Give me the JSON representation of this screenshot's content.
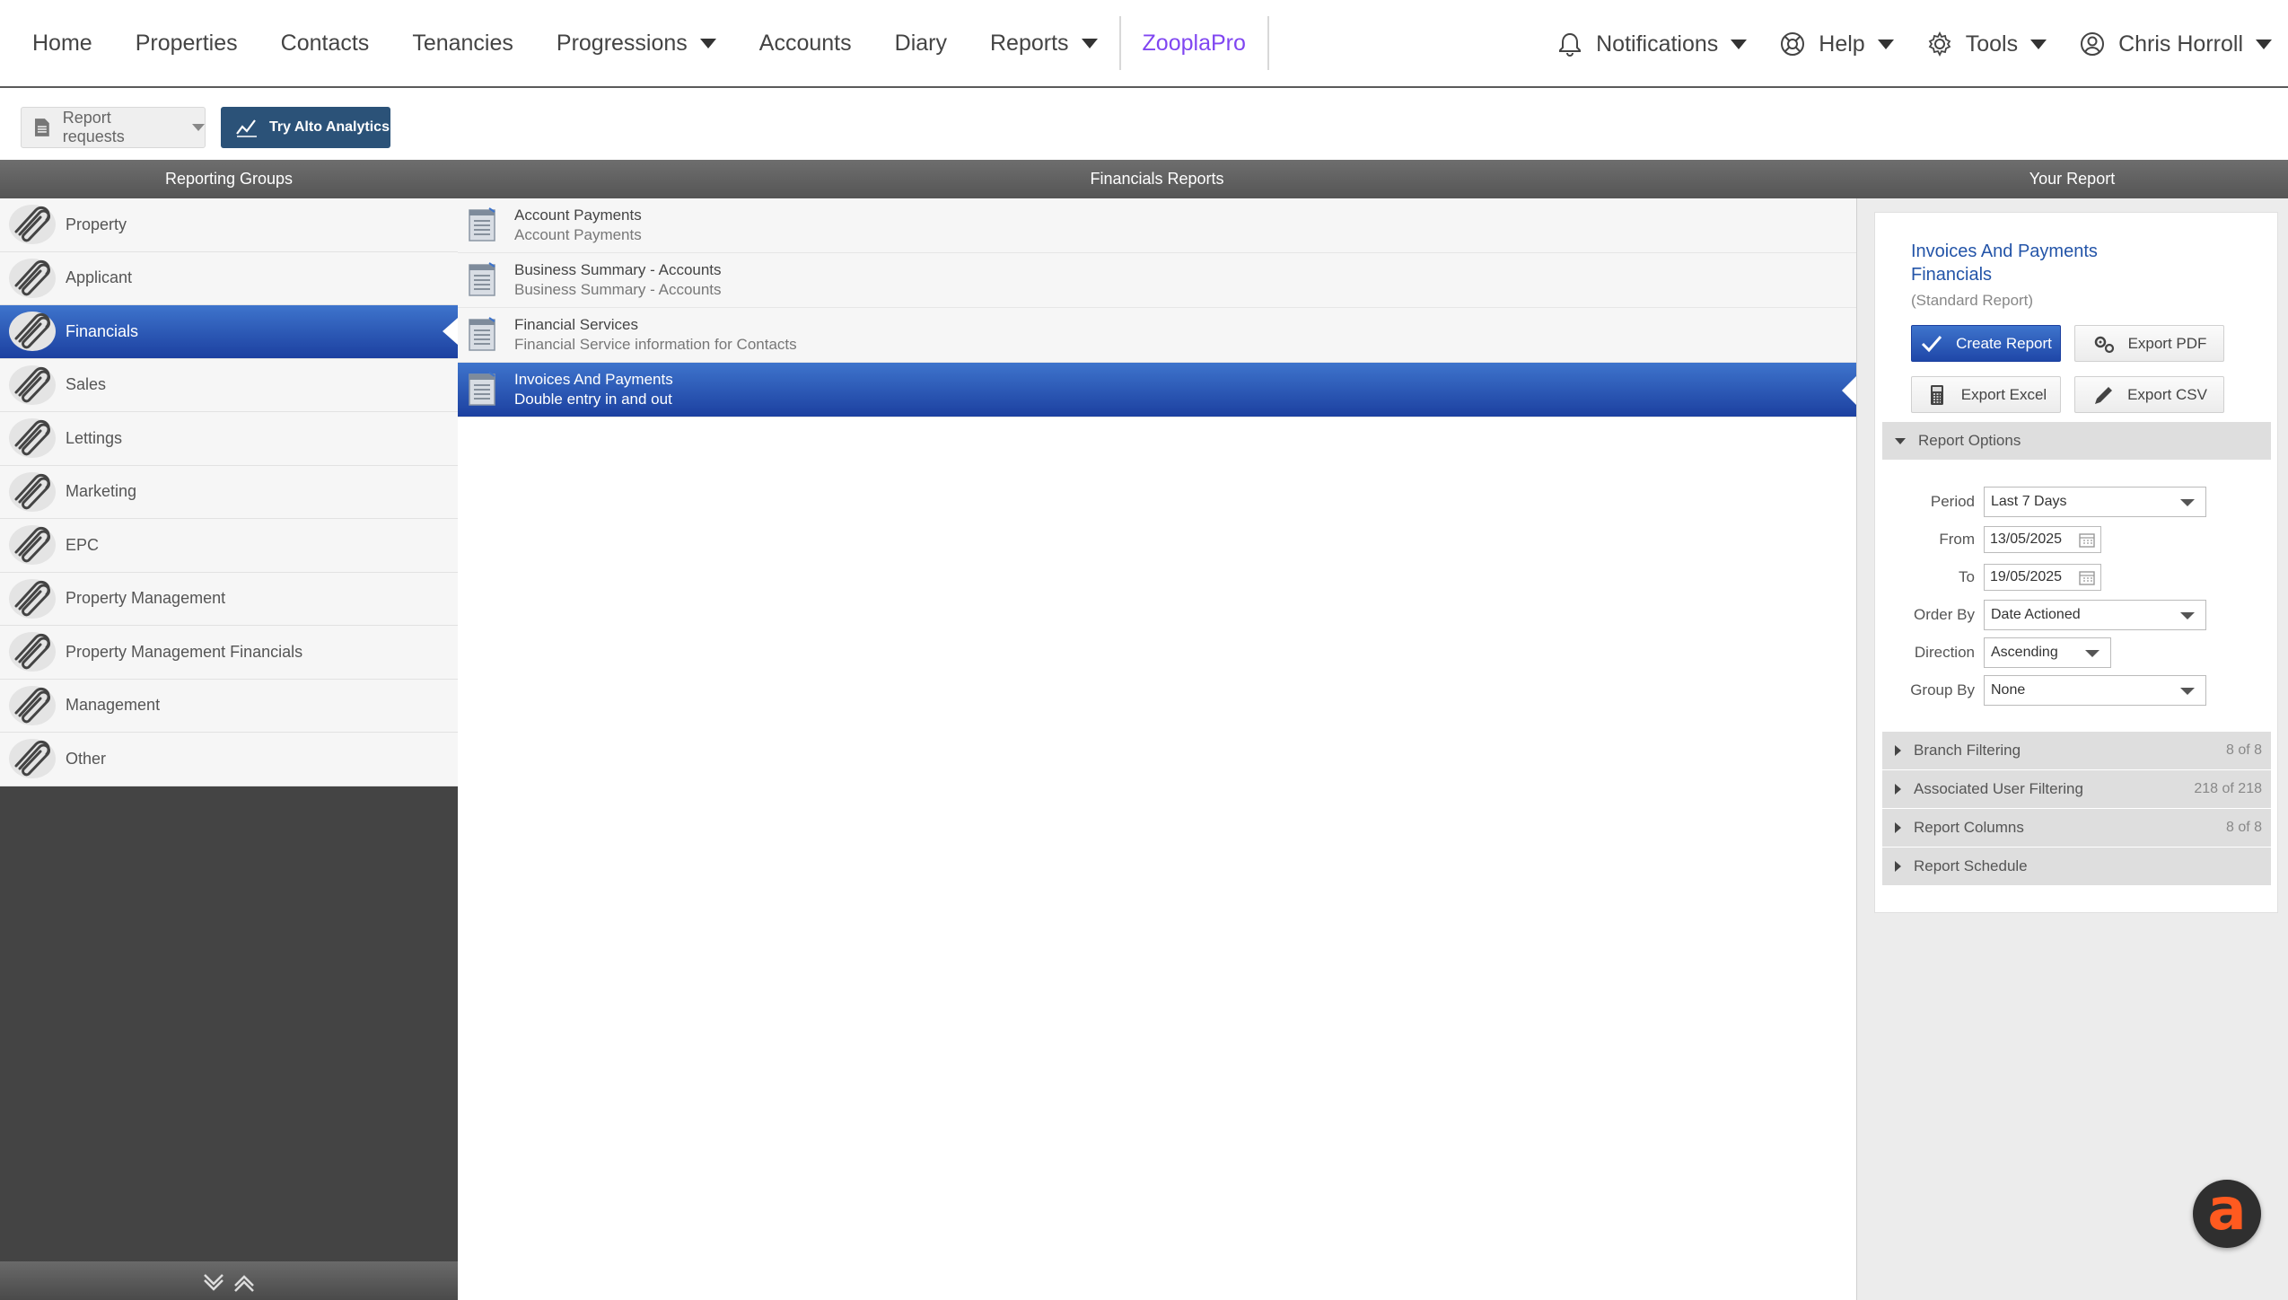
{
  "nav": {
    "items": [
      {
        "label": "Home"
      },
      {
        "label": "Properties"
      },
      {
        "label": "Contacts"
      },
      {
        "label": "Tenancies"
      },
      {
        "label": "Progressions",
        "dropdown": true
      },
      {
        "label": "Accounts"
      },
      {
        "label": "Diary"
      },
      {
        "label": "Reports",
        "dropdown": true
      }
    ],
    "zoopla": "ZooplaPro",
    "notifications": "Notifications",
    "help": "Help",
    "tools": "Tools",
    "user": "Chris Horroll",
    "zoopla_color": "#8046f1"
  },
  "toolbar": {
    "report_requests": "Report requests",
    "analytics": "Try Alto Analytics"
  },
  "columns": {
    "groups_header": "Reporting Groups",
    "reports_header": "Financials Reports",
    "your_report_header": "Your Report"
  },
  "groups": [
    {
      "label": "Property",
      "active": false
    },
    {
      "label": "Applicant",
      "active": false
    },
    {
      "label": "Financials",
      "active": true
    },
    {
      "label": "Sales",
      "active": false
    },
    {
      "label": "Lettings",
      "active": false
    },
    {
      "label": "Marketing",
      "active": false
    },
    {
      "label": "EPC",
      "active": false
    },
    {
      "label": "Property Management",
      "active": false
    },
    {
      "label": "Property Management Financials",
      "active": false
    },
    {
      "label": "Management",
      "active": false
    },
    {
      "label": "Other",
      "active": false
    }
  ],
  "reports": [
    {
      "title": "Account Payments",
      "desc": "Account Payments",
      "active": false
    },
    {
      "title": "Business Summary - Accounts",
      "desc": "Business Summary - Accounts",
      "active": false
    },
    {
      "title": "Financial Services",
      "desc": "Financial Service information for Contacts",
      "active": false
    },
    {
      "title": "Invoices And Payments",
      "desc": "Double entry in and out",
      "active": true
    }
  ],
  "your_report": {
    "title_line1": "Invoices And Payments",
    "title_line2": "Financials",
    "subtitle": "(Standard Report)",
    "buttons": {
      "create": "Create Report",
      "export_pdf": "Export PDF",
      "export_excel": "Export Excel",
      "export_csv": "Export CSV"
    },
    "options_header": "Report Options",
    "options": {
      "period_label": "Period",
      "period_value": "Last 7 Days",
      "from_label": "From",
      "from_value": "13/05/2025",
      "to_label": "To",
      "to_value": "19/05/2025",
      "order_by_label": "Order By",
      "order_by_value": "Date Actioned",
      "direction_label": "Direction",
      "direction_value": "Ascending",
      "group_by_label": "Group By",
      "group_by_value": "None"
    },
    "sections": [
      {
        "label": "Branch Filtering",
        "count": "8 of 8"
      },
      {
        "label": "Associated User Filtering",
        "count": "218 of 218"
      },
      {
        "label": "Report Columns",
        "count": "8 of 8"
      },
      {
        "label": "Report Schedule",
        "count": ""
      }
    ]
  },
  "chat": {
    "letter": "a",
    "color": "#ff5a1f"
  },
  "icons": {
    "group_item": "paperclip-icon",
    "report_item": "report-document-icon"
  }
}
